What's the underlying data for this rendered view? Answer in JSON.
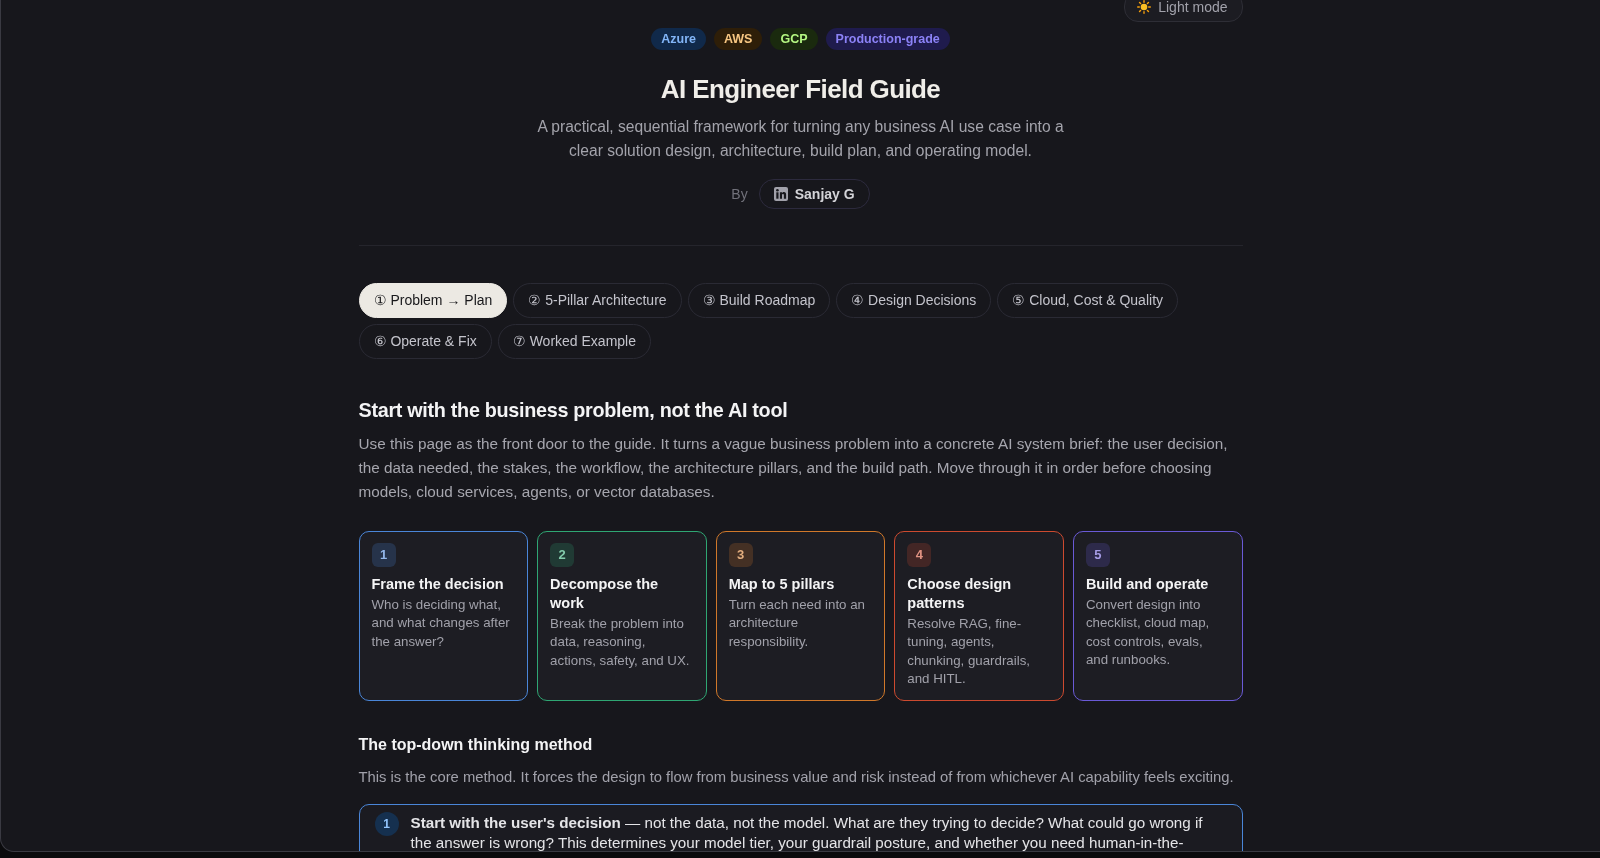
{
  "theme_toggle": {
    "label": "Light mode"
  },
  "tags": [
    {
      "label": "Azure",
      "color": "#10294a"
    },
    {
      "label": "AWS",
      "color": "#2e1e08"
    },
    {
      "label": "GCP",
      "color": "#1a2a0e"
    },
    {
      "label": "Production-grade",
      "color": "#1f1b4d"
    }
  ],
  "title": "AI Engineer Field Guide",
  "subtitle": "A practical, sequential framework for turning any business AI use case into a clear solution design, architecture, build plan, and operating model.",
  "byline": {
    "label": "By",
    "author": "Sanjay G"
  },
  "tabs": [
    {
      "label": "① Problem → Plan",
      "selected": true
    },
    {
      "label": "② 5-Pillar Architecture",
      "selected": false
    },
    {
      "label": "③ Build Roadmap",
      "selected": false
    },
    {
      "label": "④ Design Decisions",
      "selected": false
    },
    {
      "label": "⑤ Cloud, Cost & Quality",
      "selected": false
    },
    {
      "label": "⑥ Operate & Fix",
      "selected": false
    },
    {
      "label": "⑦ Worked Example",
      "selected": false
    }
  ],
  "overview": {
    "heading": "Start with the business problem, not the AI tool",
    "intro": "Use this page as the front door to the guide. It turns a vague business problem into a concrete AI system brief: the user decision, the data needed, the stakes, the workflow, the architecture pillars, and the build path. Move through it in order before choosing models, cloud services, agents, or vector databases."
  },
  "steps": [
    {
      "number": "1",
      "title": "Frame the decision",
      "description": "Who is deciding what, and what changes after the answer?",
      "color": "#4a86d8"
    },
    {
      "number": "2",
      "title": "Decompose the work",
      "description": "Break the problem into data, reasoning, actions, safety, and UX.",
      "color": "#2fa673"
    },
    {
      "number": "3",
      "title": "Map to 5 pillars",
      "description": "Turn each need into an architecture responsibility.",
      "color": "#d0782a"
    },
    {
      "number": "4",
      "title": "Choose design patterns",
      "description": "Resolve RAG, fine-tuning, agents, chunking, guardrails, and HITL.",
      "color": "#cc4a2f"
    },
    {
      "number": "5",
      "title": "Build and operate",
      "description": "Convert design into checklist, cloud map, cost controls, evals, and runbooks.",
      "color": "#6a5ad6"
    }
  ],
  "method": {
    "heading": "The top-down thinking method",
    "intro": "This is the core method. It forces the design to flow from business value and risk instead of from whichever AI capability feels exciting.",
    "items": [
      {
        "number": "1",
        "text": "**Start with the user's decision** — not the data, not the model. What are they trying to decide? What could go wrong if the answer is wrong? This determines your model tier, your guardrail posture, and whether you need human-in-the-"
      }
    ]
  }
}
